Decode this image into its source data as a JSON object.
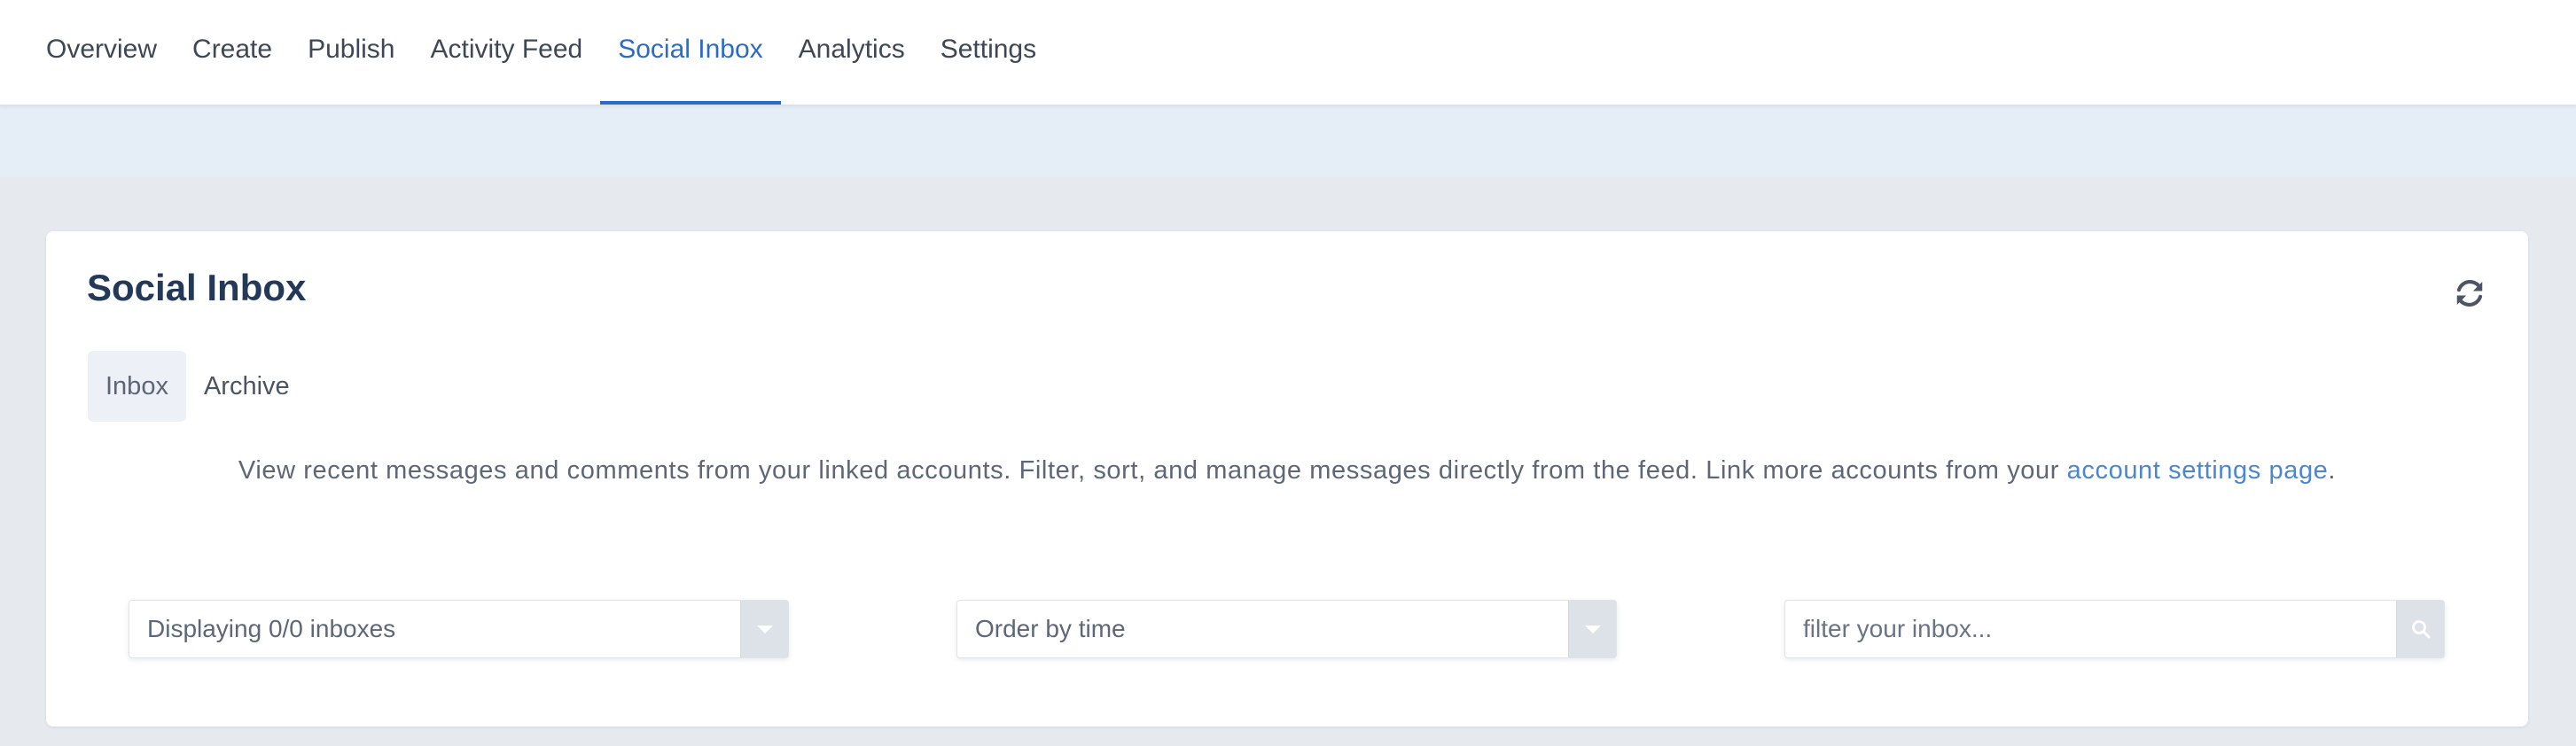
{
  "nav": {
    "items": [
      {
        "label": "Overview"
      },
      {
        "label": "Create"
      },
      {
        "label": "Publish"
      },
      {
        "label": "Activity Feed"
      },
      {
        "label": "Social Inbox"
      },
      {
        "label": "Analytics"
      },
      {
        "label": "Settings"
      }
    ],
    "active": "Social Inbox"
  },
  "card": {
    "title": "Social Inbox",
    "refresh_icon": "refresh-icon",
    "tabs": [
      {
        "label": "Inbox"
      },
      {
        "label": "Archive"
      }
    ],
    "active_tab": "Inbox",
    "description": "View recent messages and comments from your linked accounts. Filter, sort, and manage messages directly from the feed. Link more accounts from your ",
    "description_link": "account settings page",
    "description_end": "."
  },
  "filters": {
    "inbox_select": "Displaying 0/0 inboxes",
    "order_select": "Order by time",
    "search_placeholder": "filter your inbox..."
  },
  "colors": {
    "accent": "#2d6ac8",
    "link": "#4a86d4",
    "title": "#243858"
  }
}
